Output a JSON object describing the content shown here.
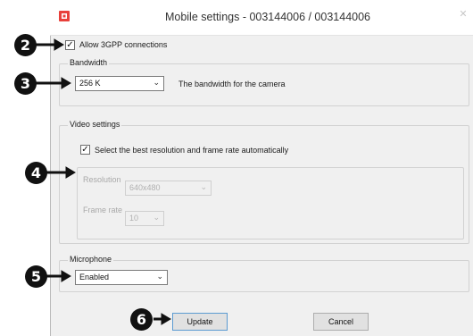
{
  "window": {
    "title": "Mobile settings - 003144006 / 003144006",
    "close_glyph": "✕"
  },
  "allow_3gpp": {
    "label": "Allow 3GPP connections",
    "checked": true
  },
  "bandwidth": {
    "group_label": "Bandwidth",
    "value": "256 K",
    "description": "The bandwidth for the camera"
  },
  "video_settings": {
    "group_label": "Video settings",
    "auto_label": "Select the best resolution and frame rate automatically",
    "auto_checked": true,
    "resolution_label": "Resolution",
    "resolution_value": "640x480",
    "frame_rate_label": "Frame rate",
    "frame_rate_value": "10"
  },
  "microphone": {
    "group_label": "Microphone",
    "value": "Enabled"
  },
  "buttons": {
    "update": "Update",
    "cancel": "Cancel"
  },
  "callouts": {
    "c2": "2",
    "c3": "3",
    "c4": "4",
    "c5": "5",
    "c6": "6"
  },
  "icons": {
    "app": "app-logo-icon",
    "chevron": "chevron-down-icon",
    "check": "checkmark-icon",
    "arrow": "arrow-right-icon"
  },
  "colors": {
    "app_icon": "#e8403a",
    "default_button_border": "#5c9bd1"
  }
}
